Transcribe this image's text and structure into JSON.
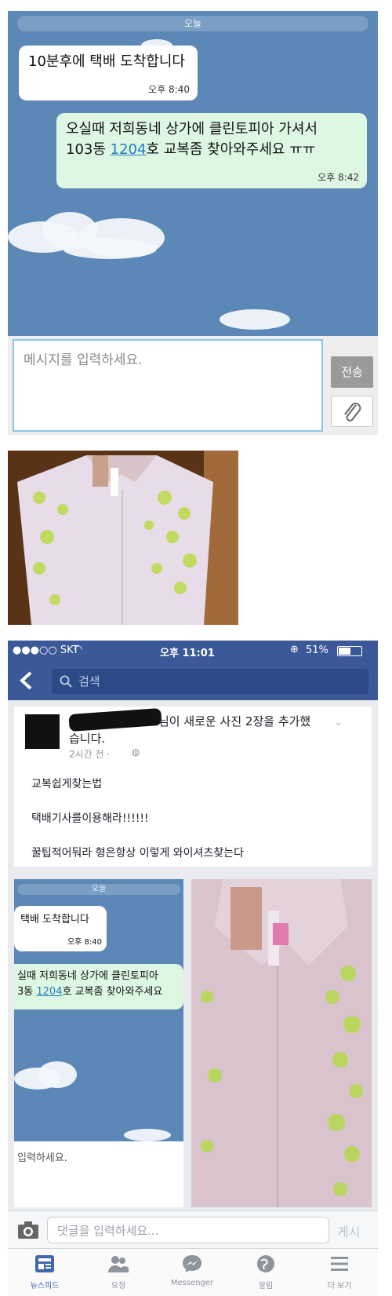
{
  "chat": {
    "day_label": "오늘",
    "messages": [
      {
        "text": "10분후에 택배 도착합니다",
        "time": "오후 8:40"
      },
      {
        "line1": "오실때 저희동네 상가에 클린토피아 가셔서",
        "line2_prefix": "103동 ",
        "line2_link": "1204",
        "line2_suffix": "호 교복좀 찾아와주세요 ㅠㅠ",
        "time": "오후 8:42"
      }
    ],
    "input_placeholder": "메시지를 입력하세요.",
    "send_label": "전송"
  },
  "facebook": {
    "status": {
      "carrier": "●●●○○ SKT",
      "time": "오후 11:01",
      "battery": "51%"
    },
    "search_placeholder": "검색",
    "post": {
      "header_suffix": "님이 새로운 사진 2장을 추가했",
      "header_line2": "습니다.",
      "meta": "2시간 전 · ",
      "lines": [
        "교복쉽게찾는법",
        "택배기사를이용해라!!!!!!",
        "꿀팁적어둬라 형은항상 이렇게 와이셔츠찾는다"
      ]
    },
    "embedded_chat": {
      "day_label": "오늘",
      "msg1": "택배 도착합니다",
      "msg1_time": "오후 8:40",
      "msg2_line1": "실때 저희동네 상가에 클린토피아",
      "msg2_line2_prefix": "3동 ",
      "msg2_link": "1204",
      "msg2_line2_suffix": "호 교복좀 찾아와주세요",
      "input_partial": "입력하세요."
    },
    "comment_placeholder": "댓글을 입력하세요...",
    "post_button": "게시",
    "tabs": [
      "뉴스피드",
      "요청",
      "Messenger",
      "알림",
      "더 보기"
    ]
  },
  "colors": {
    "chat_bg": "#5b88b6",
    "fb_blue": "#3b5998",
    "outgoing_bubble": "#ddf7e2"
  }
}
